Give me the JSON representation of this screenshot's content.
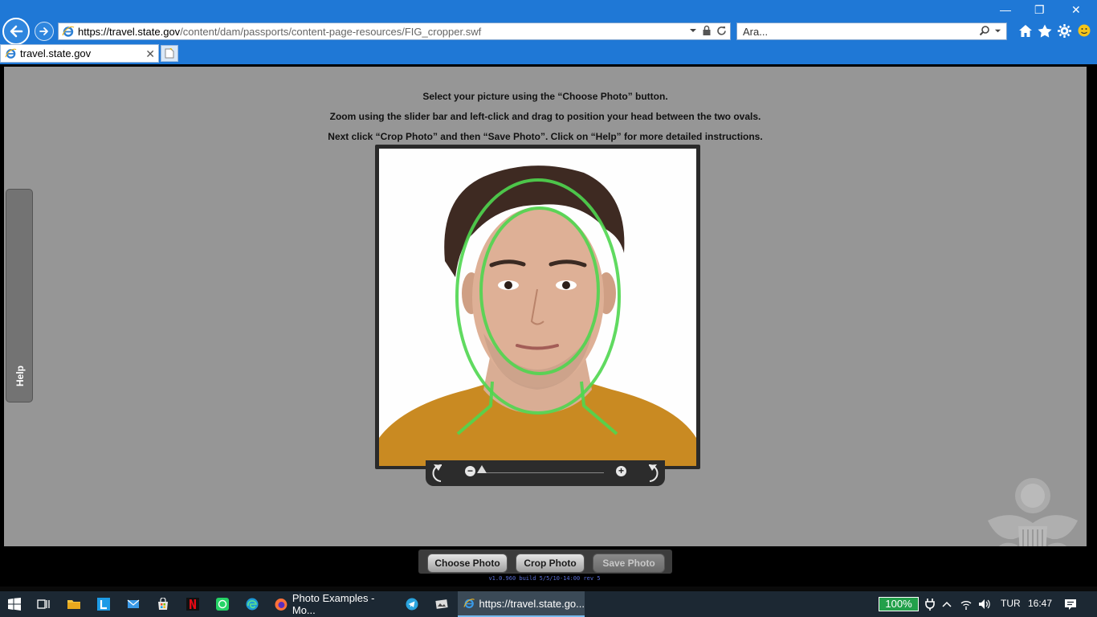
{
  "browser": {
    "url_host": "https://travel.state.gov",
    "url_path": "/content/dam/passports/content-page-resources/FIG_cropper.swf",
    "search_placeholder": "Ara...",
    "tab_title": "travel.state.gov",
    "tab_close": "✕"
  },
  "window_controls": {
    "minimize": "—",
    "restore": "❐",
    "close": "✕"
  },
  "app": {
    "instructions": [
      "Select your picture using the “Choose Photo” button.",
      "Zoom using the slider bar and left-click and drag to position your head between the two ovals.",
      "Next click “Crop Photo” and then “Save Photo”.  Click on “Help” for more detailed instructions."
    ],
    "help_label": "Help",
    "zoom": {
      "minus": "−",
      "plus": "+",
      "level": 0.0
    },
    "buttons": {
      "choose": "Choose Photo",
      "crop": "Crop Photo",
      "save": "Save Photo"
    },
    "version": "v1.0.960 build 5/5/10-14:00 rev 5"
  },
  "taskbar": {
    "photo_examples": "Photo Examples - Mo...",
    "ie_task": "https://travel.state.go...",
    "battery": "100%",
    "language": "TUR",
    "time": "16:47"
  },
  "colors": {
    "chrome": "#1f78d6",
    "stage": "#969696",
    "oval": "#4fd64f",
    "taskbar": "#1c2833"
  }
}
